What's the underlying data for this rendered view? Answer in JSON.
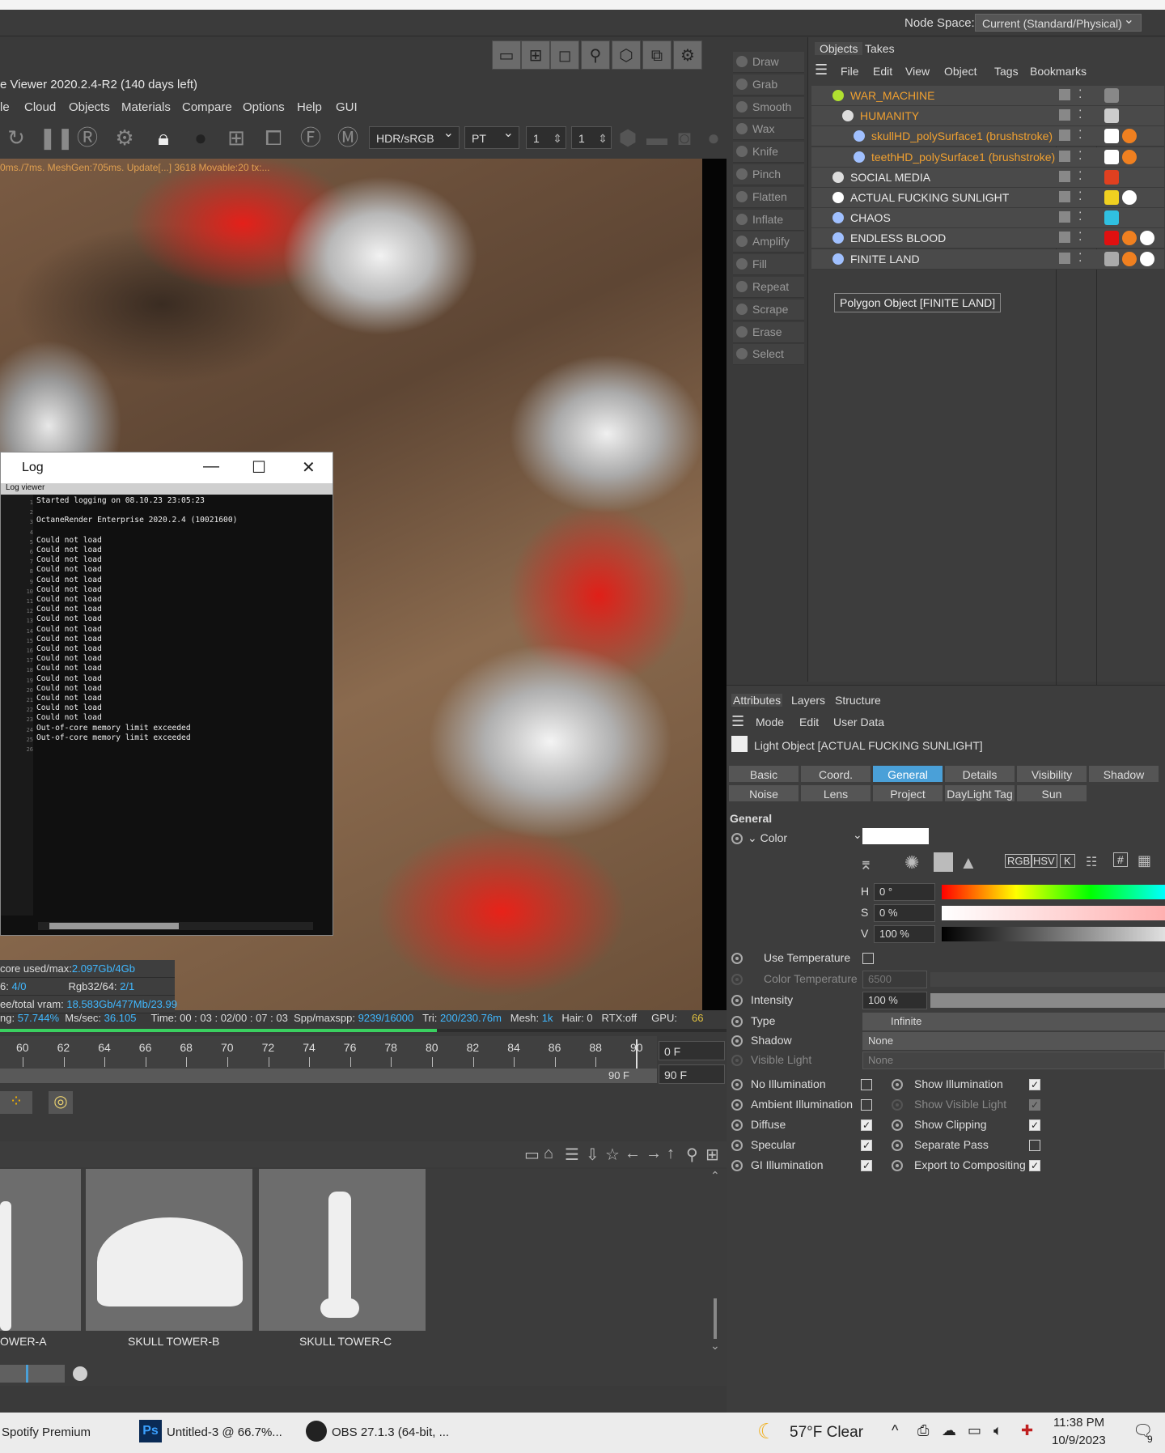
{
  "node_space": {
    "label": "Node Space:",
    "value": "Current (Standard/Physical)"
  },
  "viewer": {
    "title": "e Viewer 2020.2.4-R2 (140 days left)",
    "menu": [
      "le",
      "Cloud",
      "Objects",
      "Materials",
      "Compare",
      "Options",
      "Help",
      "GUI"
    ],
    "color_mode": "HDR/sRGB",
    "kernel": "PT",
    "spin1": "1",
    "spin2": "1",
    "status_text": "0ms./7ms. MeshGen:705ms. Update[...] 3618 Movable:20 tx:..."
  },
  "log": {
    "title": "Log",
    "subtitle": "Log viewer",
    "lines": "Started logging on 08.10.23 23:05:23\n\nOctaneRender Enterprise 2020.2.4 (10021600)\n\nCould not load\nCould not load\nCould not load\nCould not load\nCould not load\nCould not load\nCould not load\nCould not load\nCould not load\nCould not load\nCould not load\nCould not load\nCould not load\nCould not load\nCould not load\nCould not load\nCould not load\nCould not load\nCould not load\nOut-of-core memory limit exceeded\nOut-of-core memory limit exceeded",
    "line_numbers": "1\n2\n3\n4\n5\n6\n7\n8\n9\n10\n11\n12\n13\n14\n15\n16\n17\n18\n19\n20\n21\n22\n23\n24\n25\n26"
  },
  "memory": {
    "row1_label": "core used/max:",
    "row1_value": "2.097Gb/4Gb",
    "row2_label": "6: ",
    "row2_value": "4/0",
    "row2b_label": "Rgb32/64: ",
    "row2b_value": "2/1",
    "row3_label": "ee/total vram: ",
    "row3_value": "18.583Gb/477Mb/23.99"
  },
  "status": {
    "ng_label": "ng: ",
    "ng": "57.744%",
    "ms_label": "Ms/sec: ",
    "ms": "36.105",
    "time": "Time: 00 : 03 : 02/00 : 07 : 03",
    "spp_label": "Spp/maxspp: ",
    "spp": "9239/16000",
    "tri_label": "Tri: ",
    "tri": "200/230.76m",
    "mesh_label": "Mesh: ",
    "mesh": "1k",
    "hair": "Hair: 0",
    "rtx": "RTX:off",
    "gpu_label": "GPU:",
    "gpu": "66",
    "progress": 0.6
  },
  "timeline": {
    "ticks": [
      "60",
      "62",
      "64",
      "66",
      "68",
      "70",
      "72",
      "74",
      "76",
      "78",
      "80",
      "82",
      "84",
      "86",
      "88",
      "90"
    ],
    "start_field": "0 F",
    "end_field": "90 F",
    "end_label": "90 F"
  },
  "assets": [
    {
      "label": "OWER-A"
    },
    {
      "label": "SKULL TOWER-B"
    },
    {
      "label": "SKULL TOWER-C"
    }
  ],
  "brushes": [
    "Draw",
    "Grab",
    "Smooth",
    "Wax",
    "Knife",
    "Pinch",
    "Flatten",
    "Inflate",
    "Amplify",
    "Fill",
    "Repeat",
    "Scrape",
    "Erase",
    "Select"
  ],
  "objects_panel": {
    "tabs": [
      "Objects",
      "Takes"
    ],
    "menu": [
      "File",
      "Edit",
      "View",
      "Object",
      "Tags",
      "Bookmarks"
    ],
    "rows": [
      {
        "name": "WAR_MACHINE",
        "color": "#f0a030"
      },
      {
        "name": "HUMANITY",
        "color": "#f0a030"
      },
      {
        "name": "skullHD_polySurface1 (brushstroke)",
        "color": "#f0a030"
      },
      {
        "name": "teethHD_polySurface1 (brushstroke)",
        "color": "#f0a030"
      },
      {
        "name": "SOCIAL MEDIA",
        "color": "#eaeaea"
      },
      {
        "name": "ACTUAL FUCKING SUNLIGHT",
        "color": "#eaeaea"
      },
      {
        "name": "CHAOS",
        "color": "#eaeaea"
      },
      {
        "name": "ENDLESS BLOOD",
        "color": "#eaeaea"
      },
      {
        "name": "FINITE LAND",
        "color": "#eaeaea"
      }
    ],
    "tooltip": "Polygon Object [FINITE LAND]"
  },
  "attributes": {
    "tabs": [
      "Attributes",
      "Layers",
      "Structure"
    ],
    "menu": [
      "Mode",
      "Edit",
      "User Data"
    ],
    "header": "Light Object [ACTUAL FUCKING SUNLIGHT]",
    "prop_tabs_row1": [
      "Basic",
      "Coord.",
      "General",
      "Details",
      "Visibility",
      "Shadow"
    ],
    "prop_tabs_row2": [
      "Noise",
      "Lens",
      "Project",
      "DayLight Tag",
      "Sun"
    ],
    "active_tab": "General",
    "section": "General",
    "color_label": "Color",
    "color_modes": [
      "RGB",
      "HSV",
      "K",
      "#"
    ],
    "h_label": "H",
    "h_value": "0 °",
    "s_label": "S",
    "s_value": "0 %",
    "v_label": "V",
    "v_value": "100 %",
    "use_temperature": "Use Temperature",
    "color_temperature": "Color Temperature",
    "color_temperature_value": "6500",
    "intensity": "Intensity",
    "intensity_value": "100 %",
    "type": "Type",
    "type_value": "Infinite",
    "shadow": "Shadow",
    "shadow_value": "None",
    "visible_light": "Visible Light",
    "visible_light_value": "None",
    "left_checks": [
      {
        "label": "No Illumination",
        "checked": false
      },
      {
        "label": "Ambient Illumination",
        "checked": false
      },
      {
        "label": "Diffuse",
        "checked": true
      },
      {
        "label": "Specular",
        "checked": true
      },
      {
        "label": "GI Illumination",
        "checked": true
      }
    ],
    "right_checks": [
      {
        "label": "Show Illumination",
        "checked": true
      },
      {
        "label": "Show Visible Light",
        "checked": true
      },
      {
        "label": "Show Clipping",
        "checked": true
      },
      {
        "label": "Separate Pass",
        "checked": false
      },
      {
        "label": "Export to Compositing",
        "checked": true
      }
    ]
  },
  "taskbar": {
    "app1": "Spotify Premium",
    "app2_icon": "Ps",
    "app2": "Untitled-3 @ 66.7%...",
    "app3": "OBS 27.1.3 (64-bit, ...",
    "weather": "57°F  Clear",
    "time": "11:38 PM",
    "date": "10/9/2023",
    "notif": "9"
  }
}
